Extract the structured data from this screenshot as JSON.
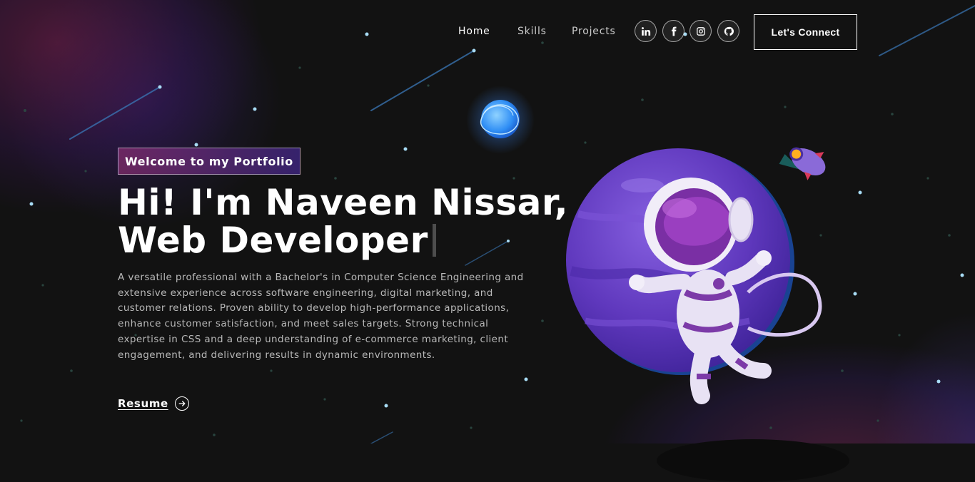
{
  "nav": {
    "links": [
      {
        "label": "Home",
        "active": true
      },
      {
        "label": "Skills",
        "active": false
      },
      {
        "label": "Projects",
        "active": false
      }
    ],
    "social_icons": [
      "linkedin-icon",
      "facebook-icon",
      "instagram-icon",
      "github-icon"
    ],
    "connect_label": "Let's Connect"
  },
  "hero": {
    "tagline": "Welcome to my Portfolio",
    "headline_line1": "Hi! I'm Naveen Nissar,",
    "headline_line2": "Web Developer",
    "description": "A versatile professional with a Bachelor's in Computer Science Engineering and extensive experience across software engineering, digital marketing, and customer relations. Proven ability to develop high-performance applications, enhance customer satisfaction, and meet sales targets. Strong technical expertise in CSS and a deep understanding of e-commerce marketing, client engagement, and delivering results in dynamic environments.",
    "resume_label": "Resume"
  },
  "colors": {
    "background": "#121212",
    "accent_pink": "#AA367C",
    "accent_purple": "#4A2FBD",
    "planet": "#6A3FC8",
    "star": "#A8DCF5"
  }
}
